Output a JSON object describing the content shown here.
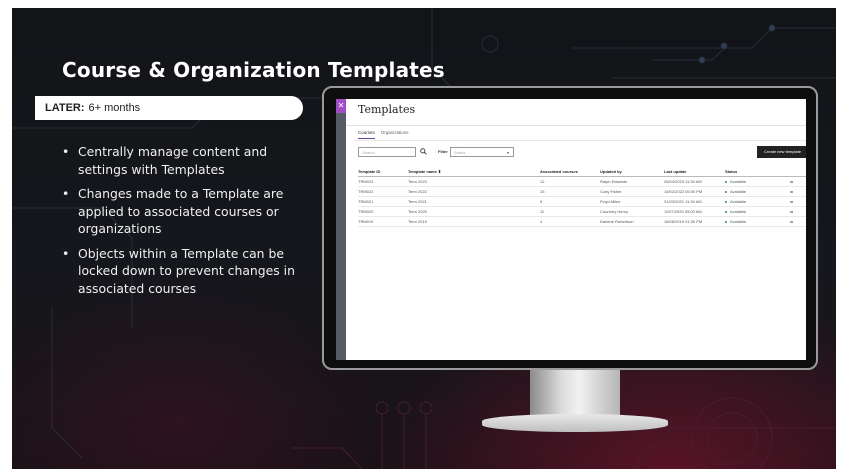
{
  "slide": {
    "title": "Course & Organization Templates",
    "phase": {
      "label": "LATER:",
      "value": "6+ months"
    },
    "bullets": [
      "Centrally manage content and settings with Templates",
      "Changes made to a Template are applied to associated courses or organizations",
      "Objects within a Template can be locked down to prevent changes in associated courses"
    ]
  },
  "app": {
    "logo": "✕",
    "title": "Templates",
    "tabs": [
      "Courses",
      "Organizations"
    ],
    "search_placeholder": "Search",
    "filter_label": "Filter",
    "status_placeholder": "Status",
    "create_button": "Create new template",
    "columns": [
      "Template ID",
      "Template name ⬍",
      "Associated courses",
      "Updated by",
      "Last update",
      "Status",
      ""
    ],
    "rows": [
      {
        "id": "TRM023",
        "name": "Term 2023",
        "courses": "12",
        "updated_by": "Ralph Edwards",
        "last_update": "26/04/2023 11:30 AM",
        "status": "Available"
      },
      {
        "id": "TRM022",
        "name": "Term 2022",
        "courses": "15",
        "updated_by": "Cody Fisher",
        "last_update": "16/02/2022 05:00 PM",
        "status": "Available"
      },
      {
        "id": "TRM021",
        "name": "Term 2021",
        "courses": "9",
        "updated_by": "Floyd Miles",
        "last_update": "31/03/2021 11:30 AM",
        "status": "Available"
      },
      {
        "id": "TRM020",
        "name": "Term 2020",
        "courses": "11",
        "updated_by": "Courtney Henry",
        "last_update": "11/07/2020 09:00 AM",
        "status": "Available"
      },
      {
        "id": "TRM019",
        "name": "Term 2019",
        "courses": "4",
        "updated_by": "Darlene Robertson",
        "last_update": "16/08/2019 01:00 PM",
        "status": "Available"
      }
    ],
    "row_action": "•••",
    "colors": {
      "accent": "#6b3fa0",
      "logo": "#a14ec4",
      "available": "#2f8f3a"
    }
  }
}
